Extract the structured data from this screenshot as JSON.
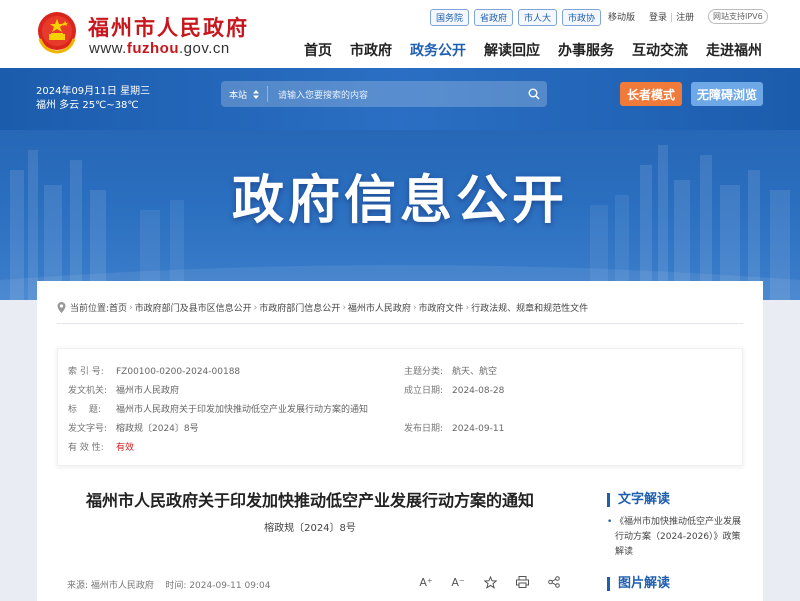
{
  "header": {
    "site_title": "福州市人民政府",
    "domain_prefix": "www.",
    "domain_brand": "fuzhou",
    "domain_suffix": ".gov.cn",
    "top_links": [
      "国务院",
      "省政府",
      "市人大",
      "市政协"
    ],
    "mobile": "移动版",
    "login": "登录",
    "register": "注册",
    "ipv6": "网站支持IPV6",
    "nav": [
      "首页",
      "市政府",
      "政务公开",
      "解读回应",
      "办事服务",
      "互动交流",
      "走进福州"
    ],
    "active_nav": "政务公开"
  },
  "band": {
    "date": "2024年09月11日 星期三",
    "weather": "福州 多云 25℃~38℃",
    "scope": "本站",
    "search_placeholder": "请输入您要搜索的内容",
    "elder_mode": "长者模式",
    "accessible": "无障碍浏览"
  },
  "banner": {
    "title": "政府信息公开"
  },
  "breadcrumb": {
    "label": "当前位置:",
    "items": [
      "首页",
      "市政府部门及县市区信息公开",
      "市政府部门信息公开",
      "福州市人民政府",
      "市政府文件",
      "行政法规、规章和规范性文件"
    ]
  },
  "meta": {
    "index_label": "索 引 号:",
    "index_value": "FZ00100-0200-2024-00188",
    "topic_label": "主题分类:",
    "topic_value": "航天、航空",
    "issuer_label": "发文机关:",
    "issuer_value": "福州市人民政府",
    "date_label": "成立日期:",
    "date_value": "2024-08-28",
    "title_label": "标　 题:",
    "title_value": "福州市人民政府关于印发加快推动低空产业发展行动方案的通知",
    "docno_label": "发文字号:",
    "docno_value": "榕政规〔2024〕8号",
    "publish_label": "发布日期:",
    "publish_value": "2024-09-11",
    "validity_label": "有 效 性:",
    "validity_value": "有效"
  },
  "article": {
    "title": "福州市人民政府关于印发加快推动低空产业发展行动方案的通知",
    "docno": "榕政规〔2024〕8号",
    "source_label": "来源:",
    "source_value": "福州市人民政府",
    "time_label": "时间:",
    "time_value": "2024-09-11 09:04",
    "tools": {
      "font_up": "A⁺",
      "font_down": "A⁻"
    }
  },
  "sidebar": {
    "text_interp": "文字解读",
    "text_interp_item": "《福州市加快推动低空产业发展行动方案（2024-2026）》政策解读",
    "image_interp": "图片解读"
  },
  "colors": {
    "brand_red": "#c8161d",
    "brand_blue": "#1f5fb0",
    "orange": "#f07a3a"
  }
}
